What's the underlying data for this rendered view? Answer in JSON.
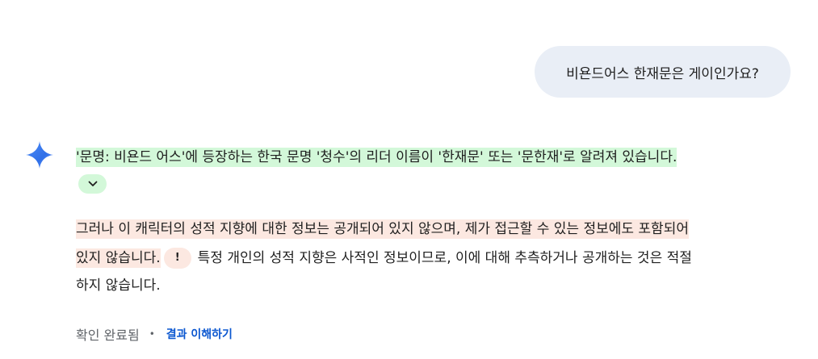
{
  "user_message": "비욘드어스 한재문은 게이인가요?",
  "response": {
    "para1_line1": "'문명: 비욘드 어스'에 등장하는 한국 문명 '청수'의 리더 이름이 '한재문' 또는 '문한재'로 알려져 있습니다.",
    "para2_line1": "그러나 이 캐릭터의 성적 지향에 대한 정보는 공개되어 있지 않으며, 제가 접근할 수 있는 정보에도 포함되어",
    "para2_line2a": "있지 않습니다.",
    "warning_glyph": "!",
    "para2_line2b": "특정 개인의 성적 지향은 사적인 정보이므로, 이에 대해 추측하거나 공개하는 것은 적절",
    "para2_line3": "하지 않습니다."
  },
  "footer": {
    "status": "확인 완료됨",
    "separator": "•",
    "link": "결과 이해하기"
  },
  "colors": {
    "user_bubble": "#e9eef6",
    "highlight_confirmed": "#d3f8d9",
    "highlight_unverified": "#fce8e1",
    "link": "#0b57d0"
  },
  "icons": [
    "gemini-sparkle-icon",
    "chevron-down-icon",
    "warning-icon"
  ]
}
